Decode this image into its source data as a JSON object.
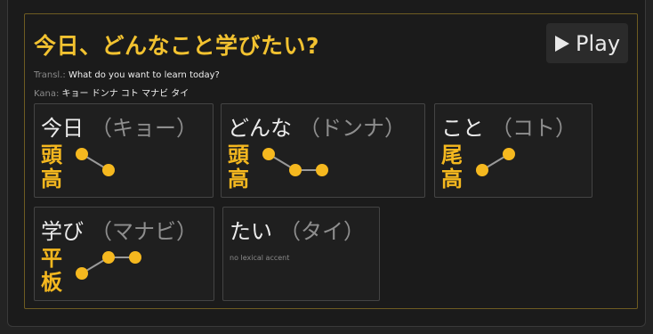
{
  "title": "今日、どんなこと学びたい?",
  "play": {
    "label": "Play",
    "icon": "play-icon"
  },
  "translation": {
    "label": "Transl.:",
    "text": "What do you want to learn today?"
  },
  "kana": {
    "label": "Kana:",
    "text": "キョー ドンナ コト マナビ タイ"
  },
  "colors": {
    "accent": "#f2c230",
    "pitch_dot": "#f5b81f",
    "pitch_line": "#9a9a9a"
  },
  "words": [
    {
      "word": "今日",
      "kana": "（キョー）",
      "accent_type": "頭高",
      "pitch": [
        1,
        0
      ]
    },
    {
      "word": "どんな",
      "kana": "（ドンナ）",
      "accent_type": "頭高",
      "pitch": [
        1,
        0,
        0
      ]
    },
    {
      "word": "こと",
      "kana": "（コト）",
      "accent_type": "尾高",
      "pitch": [
        0,
        1
      ]
    },
    {
      "word": "学び",
      "kana": "（マナビ）",
      "accent_type": "平板",
      "pitch": [
        0,
        1,
        1
      ]
    },
    {
      "word": "たい",
      "kana": "（タイ）",
      "accent_type": "",
      "note": "no lexical accent",
      "pitch": []
    }
  ]
}
